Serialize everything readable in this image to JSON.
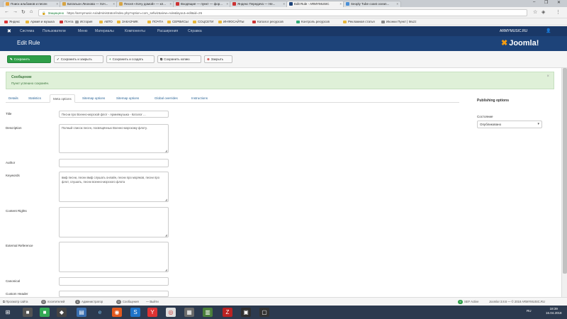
{
  "browser": {
    "tabs": [
      {
        "label": "Поиск альбомов и песен",
        "color": "#e8a23a",
        "active": false
      },
      {
        "label": "Батальон Леонова — Хоч...",
        "color": "#d6a444",
        "active": false
      },
      {
        "label": "Песня «Хочу домой» — кл...",
        "color": "#d6a444",
        "active": false
      },
      {
        "label": "Входящие — пункт — фор...",
        "color": "#c33",
        "active": false
      },
      {
        "label": "Яндекс Передача — Не...",
        "color": "#c33",
        "active": false
      },
      {
        "label": "Edit Rule - ARMYMUSIC",
        "color": "#1d4379",
        "active": true
      },
      {
        "label": "Seoply Tube coast ocean...",
        "color": "#4a8fd6",
        "active": false
      }
    ],
    "url_secure_label": "Защищено",
    "url": "https://armymusic.ru/administrator/index.php?option=com_sefwiz&view=rule&layout=edit&id=25",
    "bookmarks": [
      "Яндекс",
      "Армия и музыка",
      "Почта",
      "История",
      "АВТО",
      "ЗАКАЗЧИК",
      "ПОЧТА",
      "СЕРВИСЫ",
      "СОЦСЕТИ",
      "ИНФОСАЙТЫ",
      "Каталог ресурсов",
      "Контроль ресурсов",
      "Рекламная статья",
      "Иконки Пункт | Muzz"
    ]
  },
  "admin_nav": {
    "items": [
      "Система",
      "Пользователи",
      "Меню",
      "Материалы",
      "Компоненты",
      "Расширения",
      "Справка"
    ],
    "site_name": "ARMYMUSIC.RU"
  },
  "header": {
    "title": "Edit Rule",
    "logo_text": "Joomla!"
  },
  "toolbar": {
    "save": "Сохранить",
    "save_close": "Сохранить и закрыть",
    "save_new": "Сохранить и создать",
    "save_copy": "Сохранить копию",
    "close": "Закрыть"
  },
  "message": {
    "title": "Сообщение",
    "text": "Пункт успешно сохранён."
  },
  "edit_tabs": [
    "Details",
    "Statistics",
    "Meta options",
    "Sitemap options",
    "Sitemap options",
    "Global overrides",
    "Instructions"
  ],
  "form": {
    "title_label": "Title",
    "title_value": "Песни про Военно-морской флот - Армиямузыка - Каталог ...",
    "description_label": "Description",
    "description_value": "Полный список песен, посвящённых Военно-морскому флоту.",
    "author_label": "Author",
    "author_value": "",
    "keywords_label": "Keywords",
    "keywords_value": "вмф песни, песни вмф слушать онлайн, песни про моряков, песни про флот, слушать, песни военно-морского флота",
    "rights_label": "Content Rights",
    "rights_value": "",
    "external_label": "External Reference",
    "external_value": "",
    "canonical_label": "Canonical",
    "canonical_value": "",
    "custom_header_label": "Custom Header",
    "custom_header_value": ""
  },
  "publishing": {
    "title": "Publishing options",
    "status_label": "Состояние",
    "status_value": "Опубликовано"
  },
  "statusbar": {
    "view_site": "Просмотр сайта",
    "visitors_count": "0",
    "visitors_label": "посетителей",
    "admins_count": "1",
    "admins_label": "Администратор",
    "messages_count": "0",
    "messages_label": "Сообщения",
    "logout": "Выйти",
    "sefwiz_badge": "9",
    "sefwiz": "SEF Active",
    "version": "Joomla! 3.8.6 — © 2018 ARMYMUSIC.RU"
  },
  "taskbar": {
    "lang": "RU",
    "time": "18:39",
    "date": "16.04.2018"
  }
}
